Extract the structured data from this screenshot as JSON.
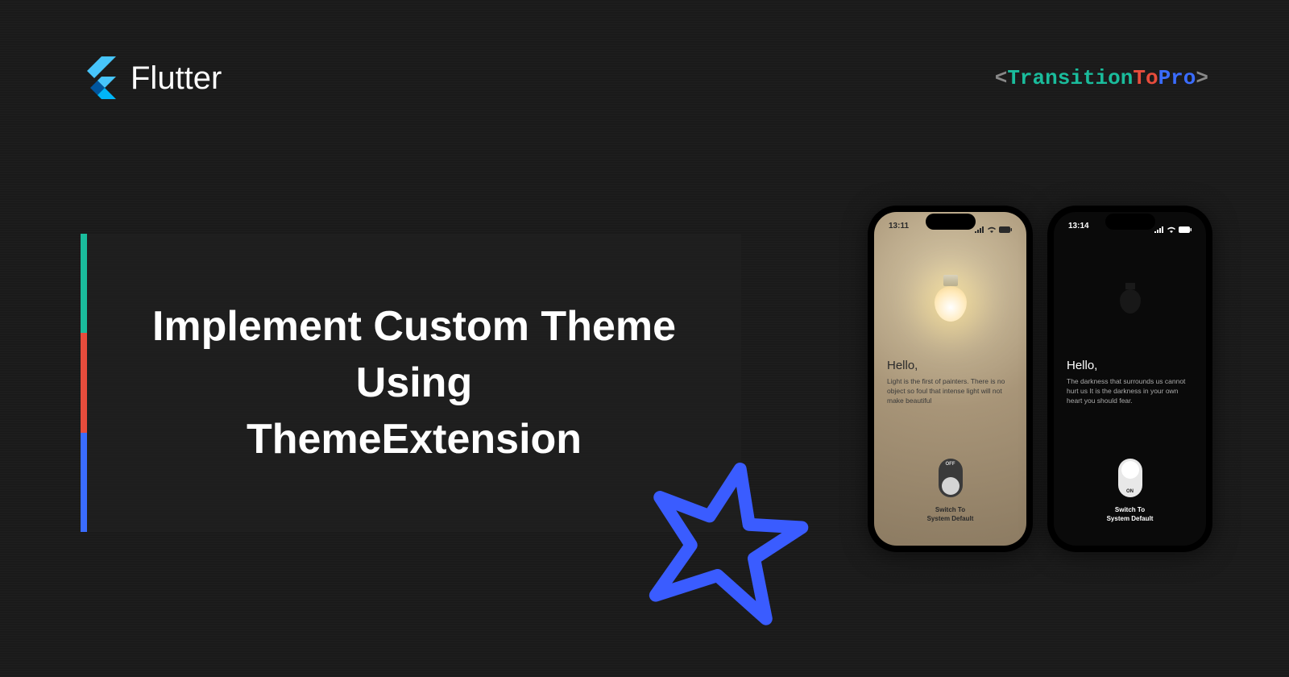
{
  "header": {
    "flutter_label": "Flutter",
    "brand_parts": {
      "bracket_open": "<",
      "word1": "Transition",
      "word2": "To",
      "word3": "Pro",
      "bracket_close": ">"
    }
  },
  "title": {
    "line1": "Implement Custom Theme",
    "line2": "Using",
    "line3": "ThemeExtension"
  },
  "phones": {
    "light": {
      "time": "13:11",
      "greeting": "Hello,",
      "quote": "Light is the first of painters. There is no object so foul that intense light will not make beautiful",
      "toggle_state": "OFF",
      "switch_line1": "Switch To",
      "switch_line2": "System Default"
    },
    "dark": {
      "time": "13:14",
      "greeting": "Hello,",
      "quote": "The darkness that surrounds us cannot hurt us It is the darkness in your own heart you should fear.",
      "toggle_state": "ON",
      "switch_line1": "Switch To",
      "switch_line2": "System Default"
    }
  },
  "colors": {
    "accent_green": "#1abc9c",
    "accent_red": "#e74c3c",
    "accent_blue": "#3a6cff"
  }
}
